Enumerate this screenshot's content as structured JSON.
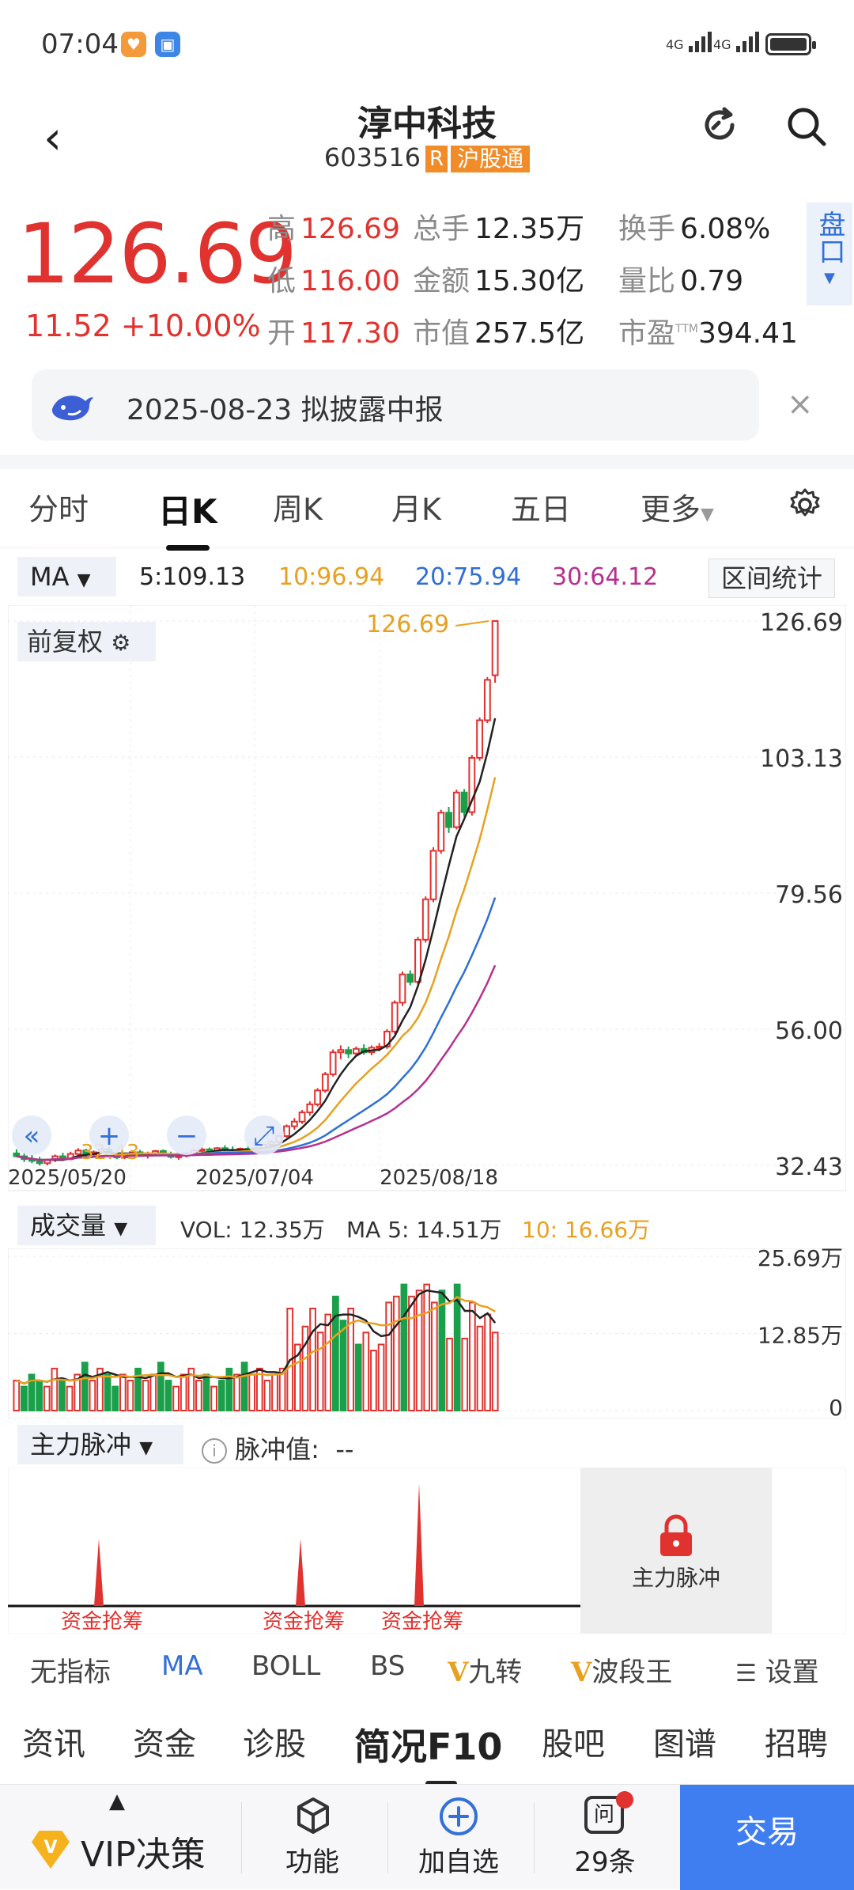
{
  "status": {
    "time": "07:04",
    "net1": "4G",
    "net2": "4G"
  },
  "header": {
    "title": "淳中科技",
    "code": "603516",
    "badge_r": "R",
    "badge_hgt": "沪股通"
  },
  "quote": {
    "price": "126.69",
    "change": "11.52",
    "change_pct": "+10.00%",
    "high_k": "高",
    "high": "126.69",
    "low_k": "低",
    "low": "116.00",
    "open_k": "开",
    "open": "117.30",
    "vol_k": "总手",
    "vol": "12.35万",
    "amt_k": "金额",
    "amt": "15.30亿",
    "cap_k": "市值",
    "cap": "257.5亿",
    "turn_k": "换手",
    "turn": "6.08%",
    "ratio_k": "量比",
    "ratio": "0.79",
    "pe_k": "市盈",
    "pe_sup": "TTM",
    "pe": "394.41",
    "pankou": "盘口"
  },
  "notice": {
    "text": "2025-08-23 拟披露中报"
  },
  "tabs": [
    "分时",
    "日K",
    "周K",
    "月K",
    "五日",
    "更多"
  ],
  "ma": {
    "select": "MA",
    "ma5": "5:109.13",
    "ma10": "10:96.94",
    "ma20": "20:75.94",
    "ma30": "30:64.12",
    "range_btn": "区间统计",
    "colors": {
      "ma5": "#222222",
      "ma10": "#e8a020",
      "ma20": "#2f6fd6",
      "ma30": "#b8308e"
    }
  },
  "fuquan": "前复权",
  "chart_data": {
    "type": "candlestick",
    "y_ticks": [
      "126.69",
      "103.13",
      "79.56",
      "56.00",
      "32.43"
    ],
    "ylim": [
      32.43,
      126.69
    ],
    "x_ticks": [
      "2025/05/20",
      "2025/07/04",
      "2025/08/18"
    ],
    "max_label": "126.69",
    "min_label": "32.43",
    "candles": [
      [
        34.5,
        35.2,
        33.8,
        34.0
      ],
      [
        34.0,
        34.6,
        33.0,
        33.5
      ],
      [
        33.5,
        34.2,
        32.8,
        33.2
      ],
      [
        33.2,
        33.9,
        32.4,
        32.8
      ],
      [
        32.8,
        33.6,
        32.43,
        33.4
      ],
      [
        33.4,
        34.3,
        33.0,
        34.0
      ],
      [
        34.0,
        34.6,
        33.2,
        33.5
      ],
      [
        33.5,
        34.8,
        33.3,
        34.4
      ],
      [
        34.4,
        35.4,
        34.0,
        35.0
      ],
      [
        35.0,
        35.3,
        34.0,
        34.3
      ],
      [
        34.3,
        35.0,
        33.8,
        34.7
      ],
      [
        34.7,
        35.5,
        34.4,
        35.2
      ],
      [
        35.2,
        35.6,
        34.0,
        34.4
      ],
      [
        34.4,
        34.9,
        33.5,
        33.8
      ],
      [
        33.8,
        34.6,
        33.5,
        34.3
      ],
      [
        34.3,
        35.0,
        34.0,
        34.7
      ],
      [
        34.7,
        35.1,
        33.9,
        34.1
      ],
      [
        34.1,
        34.8,
        33.6,
        34.5
      ],
      [
        34.5,
        35.1,
        34.0,
        34.9
      ],
      [
        34.9,
        35.2,
        34.2,
        34.4
      ],
      [
        34.4,
        34.8,
        33.6,
        33.9
      ],
      [
        33.9,
        34.4,
        33.4,
        34.1
      ],
      [
        34.1,
        34.7,
        33.8,
        34.5
      ],
      [
        34.5,
        35.3,
        34.2,
        35.0
      ],
      [
        35.0,
        35.6,
        34.6,
        35.2
      ],
      [
        35.2,
        35.5,
        34.5,
        34.8
      ],
      [
        34.8,
        35.6,
        34.5,
        35.4
      ],
      [
        35.4,
        35.9,
        34.8,
        35.1
      ],
      [
        35.1,
        35.7,
        34.6,
        34.9
      ],
      [
        34.9,
        35.5,
        34.5,
        35.3
      ],
      [
        35.3,
        35.8,
        34.8,
        35.0
      ],
      [
        35.0,
        35.6,
        34.6,
        35.4
      ],
      [
        35.4,
        36.2,
        35.1,
        36.0
      ],
      [
        36.0,
        36.8,
        35.6,
        36.5
      ],
      [
        36.5,
        37.8,
        36.2,
        37.5
      ],
      [
        37.5,
        39.5,
        37.2,
        39.2
      ],
      [
        39.2,
        40.6,
        38.6,
        40.0
      ],
      [
        40.0,
        42.0,
        39.6,
        41.6
      ],
      [
        41.6,
        43.5,
        41.0,
        43.0
      ],
      [
        43.0,
        45.8,
        42.6,
        45.4
      ],
      [
        45.4,
        48.6,
        45.0,
        48.2
      ],
      [
        48.2,
        52.5,
        47.8,
        52.0
      ],
      [
        52.0,
        53.2,
        50.8,
        52.4
      ],
      [
        52.4,
        53.0,
        51.0,
        51.8
      ],
      [
        51.8,
        53.0,
        51.2,
        52.6
      ],
      [
        52.6,
        53.4,
        51.6,
        52.0
      ],
      [
        52.0,
        53.2,
        51.5,
        52.8
      ],
      [
        52.8,
        53.6,
        52.2,
        53.0
      ],
      [
        53.0,
        56.0,
        52.6,
        55.6
      ],
      [
        55.6,
        61.0,
        55.2,
        60.6
      ],
      [
        60.6,
        66.0,
        60.0,
        65.5
      ],
      [
        65.5,
        66.2,
        63.6,
        64.2
      ],
      [
        64.2,
        72.0,
        63.8,
        71.5
      ],
      [
        71.5,
        79.0,
        71.0,
        78.5
      ],
      [
        78.5,
        87.5,
        78.0,
        86.9
      ],
      [
        86.9,
        94.0,
        86.4,
        93.5
      ],
      [
        93.5,
        94.5,
        90.0,
        91.0
      ],
      [
        91.0,
        97.5,
        90.6,
        97.0
      ],
      [
        97.0,
        97.6,
        92.8,
        93.6
      ],
      [
        93.6,
        103.5,
        93.0,
        103.0
      ],
      [
        103.0,
        110.0,
        102.5,
        109.5
      ],
      [
        109.5,
        117.0,
        109.0,
        116.5
      ],
      [
        117.3,
        126.69,
        116.0,
        126.69
      ]
    ],
    "ma5_end": 109.13,
    "ma10_end": 96.94,
    "ma20_end": 75.94,
    "ma30_end": 64.12,
    "zoom_labels": [
      "32.43"
    ]
  },
  "volume": {
    "select": "成交量",
    "vol": "VOL: 12.35万",
    "ma5": "MA 5: 14.51万",
    "ma10": "10: 16.66万",
    "y_ticks": [
      "25.69万",
      "12.85万",
      "0"
    ],
    "bars": [
      5,
      4,
      6,
      5,
      4,
      7,
      5,
      4,
      6,
      8,
      5,
      7,
      6,
      4,
      6,
      5,
      7,
      5,
      6,
      8,
      5,
      4,
      6,
      7,
      5,
      6,
      4,
      5,
      7,
      6,
      8,
      6,
      7,
      5,
      6,
      7,
      17,
      11,
      14,
      17,
      13,
      16,
      19,
      15,
      17,
      11,
      13,
      10,
      11,
      18,
      19,
      21,
      19,
      20,
      21,
      18,
      20,
      12,
      21,
      12,
      18,
      14,
      16,
      13
    ],
    "up": [
      1,
      0,
      0,
      0,
      1,
      1,
      0,
      1,
      1,
      0,
      1,
      1,
      0,
      0,
      1,
      1,
      0,
      1,
      1,
      0,
      0,
      1,
      1,
      1,
      1,
      0,
      1,
      0,
      0,
      1,
      0,
      1,
      1,
      1,
      1,
      1,
      1,
      1,
      1,
      1,
      1,
      1,
      0,
      0,
      1,
      0,
      1,
      1,
      1,
      1,
      1,
      0,
      1,
      1,
      1,
      1,
      0,
      1,
      0,
      1,
      1,
      1,
      1
    ]
  },
  "pulse": {
    "select": "主力脉冲",
    "label": "脉冲值:",
    "value": "--",
    "tag": "资金抢筹",
    "lock_text": "主力脉冲"
  },
  "indicators": [
    "无指标",
    "MA",
    "BOLL",
    "BS",
    "九转",
    "波段王",
    "设置"
  ],
  "f10": [
    "资讯",
    "资金",
    "诊股",
    "简况F10",
    "股吧",
    "图谱",
    "招聘"
  ],
  "bottom": {
    "vip": "VIP决策",
    "func": "功能",
    "add": "加自选",
    "msg": "29条",
    "trade": "交易",
    "msg_icon": "问"
  }
}
